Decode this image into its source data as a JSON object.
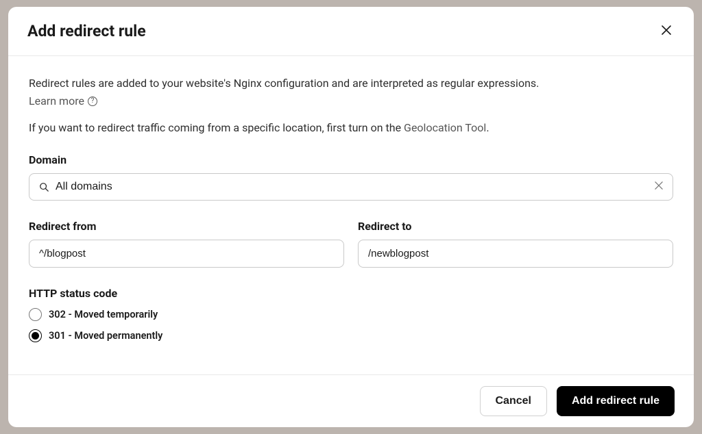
{
  "header": {
    "title": "Add redirect rule"
  },
  "body": {
    "description": "Redirect rules are added to your website's Nginx configuration and are interpreted as regular expressions.",
    "learn_more": "Learn more",
    "geo_note_prefix": "If you want to redirect traffic coming from a specific location, first turn on the ",
    "geo_link": "Geolocation Tool",
    "geo_note_suffix": "."
  },
  "domain": {
    "label": "Domain",
    "value": "All domains"
  },
  "redirect_from": {
    "label": "Redirect from",
    "value": "^/blogpost"
  },
  "redirect_to": {
    "label": "Redirect to",
    "value": "/newblogpost"
  },
  "status": {
    "label": "HTTP status code",
    "options": [
      {
        "label": "302 - Moved temporarily",
        "selected": false
      },
      {
        "label": "301 - Moved permanently",
        "selected": true
      }
    ]
  },
  "footer": {
    "cancel": "Cancel",
    "submit": "Add redirect rule"
  }
}
